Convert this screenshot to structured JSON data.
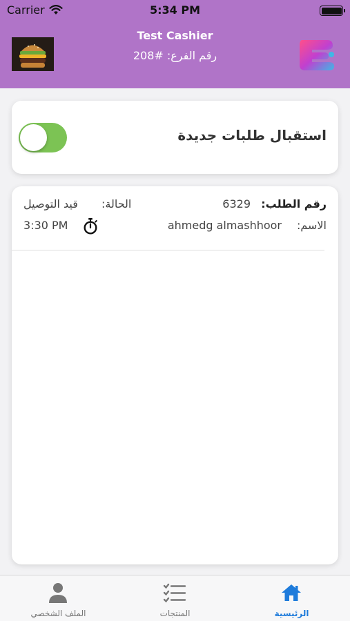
{
  "status_bar": {
    "carrier": "Carrier",
    "time": "5:34 PM"
  },
  "header": {
    "cashier_name": "Test Cashier",
    "branch_number": "رقم الفرع: #208",
    "background_color": "#b074c8",
    "avatar_icon": "burger-photo",
    "logo_icon": "app-logo"
  },
  "accept_orders": {
    "label": "استقبال طلبات جديدة",
    "enabled": true,
    "toggle_color": "#7cc354"
  },
  "orders": [
    {
      "order_number_label": "رقم الطلب:",
      "order_number": "6329",
      "status_label": "الحالة:",
      "status": "قيد التوصيل",
      "name_label": "الاسم:",
      "name": "ahmedg almashhoor",
      "time": "3:30 PM",
      "time_icon": "stopwatch-icon"
    }
  ],
  "tabbar": {
    "tabs": [
      {
        "label": "الرئيسية",
        "icon": "home-icon",
        "active": true
      },
      {
        "label": "المنتجات",
        "icon": "list-checks-icon",
        "active": false
      },
      {
        "label": "الملف الشخصي",
        "icon": "person-icon",
        "active": false
      }
    ],
    "active_color": "#1e7bdb"
  }
}
